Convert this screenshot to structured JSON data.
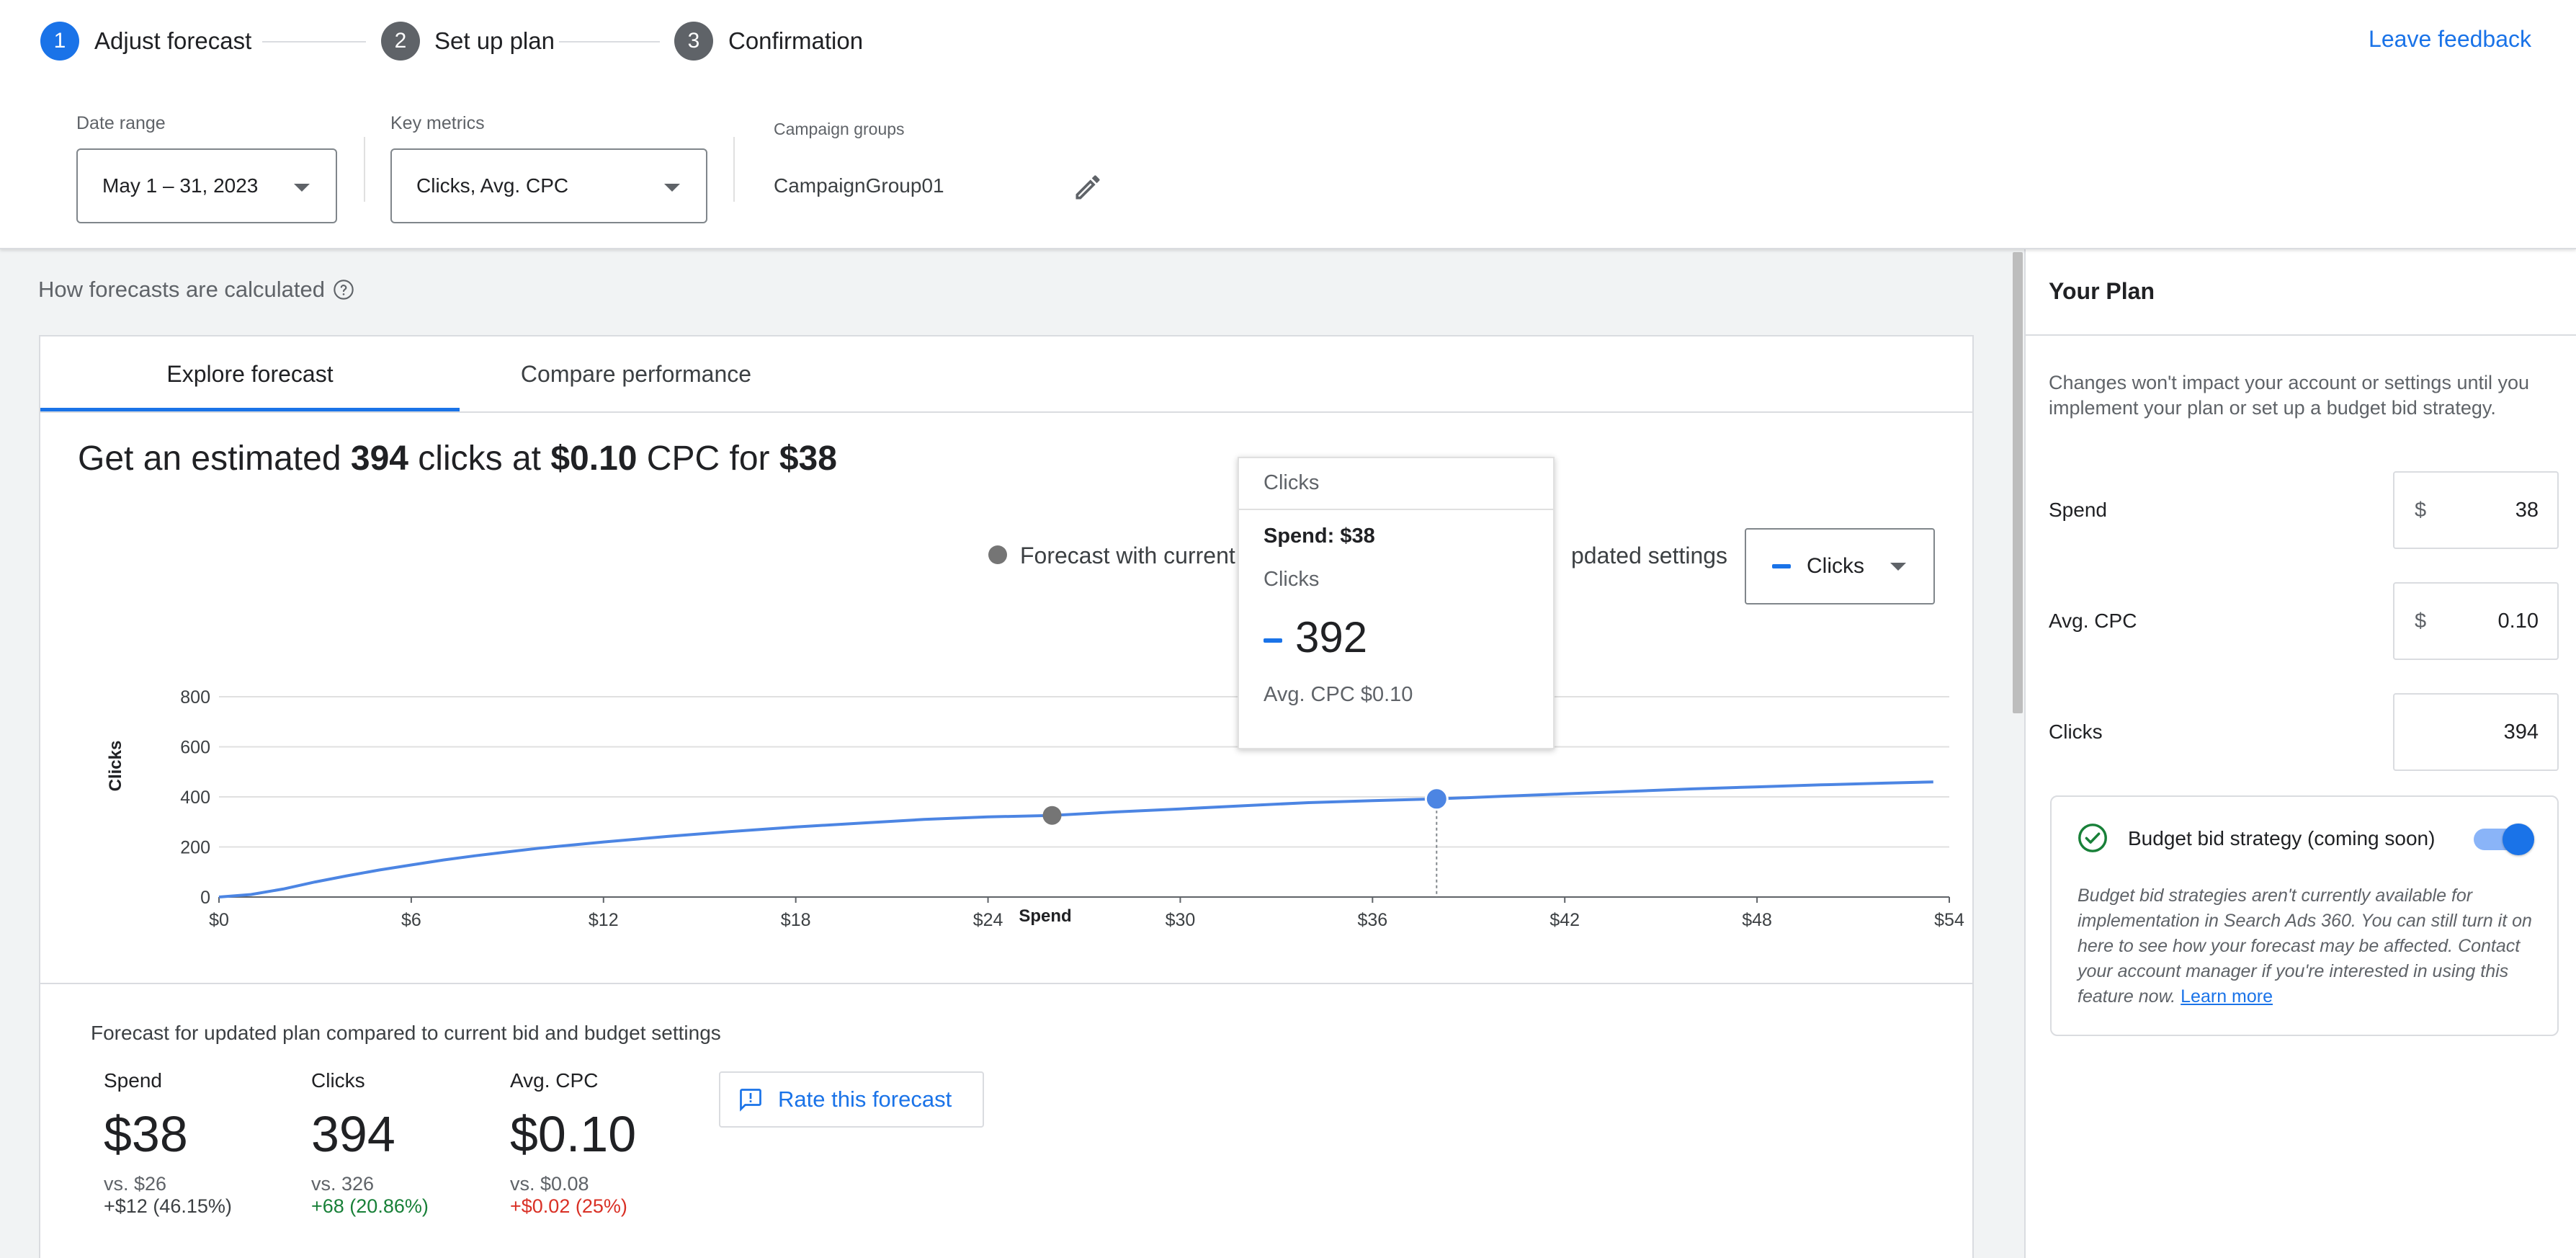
{
  "stepper": {
    "steps": [
      {
        "number": "1",
        "label": "Adjust forecast"
      },
      {
        "number": "2",
        "label": "Set up plan"
      },
      {
        "number": "3",
        "label": "Confirmation"
      }
    ],
    "feedback_link": "Leave feedback"
  },
  "filters": {
    "date_range": {
      "label": "Date range",
      "value": "May 1 – 31, 2023"
    },
    "key_metrics": {
      "label": "Key metrics",
      "value": "Clicks, Avg. CPC"
    },
    "campaign_groups": {
      "label": "Campaign groups",
      "value": "CampaignGroup01"
    }
  },
  "main": {
    "help_link": "How forecasts are calculated",
    "tabs": [
      {
        "label": "Explore forecast",
        "active": true
      },
      {
        "label": "Compare performance",
        "active": false
      }
    ],
    "headline": {
      "prefix": "Get an estimated ",
      "clicks": "394",
      "mid1": " clicks at ",
      "cpc": "$0.10",
      "mid2": " CPC for ",
      "spend": "$38"
    },
    "legend": {
      "current": "Forecast with current",
      "updated": "pdated settings"
    },
    "metric_dropdown": "Clicks",
    "comparison_caption": "Forecast for updated plan compared to current bid and budget settings",
    "stats": [
      {
        "label": "Spend",
        "value": "$38",
        "vs": "vs. $26",
        "delta": "+$12 (46.15%)",
        "tone": "neutral"
      },
      {
        "label": "Clicks",
        "value": "394",
        "vs": "vs. 326",
        "delta": "+68 (20.86%)",
        "tone": "green"
      },
      {
        "label": "Avg. CPC",
        "value": "$0.10",
        "vs": "vs. $0.08",
        "delta": "+$0.02 (25%)",
        "tone": "red"
      }
    ],
    "rate_button": "Rate this forecast"
  },
  "tooltip": {
    "header": "Clicks",
    "spend": "Spend: $38",
    "metric_label": "Clicks",
    "value": "392",
    "cpc": "Avg. CPC $0.10"
  },
  "colors": {
    "accent": "#1a73e8",
    "line": "#4c85e3",
    "current_point": "#757575",
    "green": "#188038",
    "red": "#d93025"
  },
  "chart_data": {
    "type": "line",
    "xlabel": "Spend",
    "ylabel": "Clicks",
    "xlim": [
      0,
      54
    ],
    "ylim": [
      0,
      800
    ],
    "x_ticks": [
      "$0",
      "$6",
      "$12",
      "$18",
      "$24",
      "$30",
      "$36",
      "$42",
      "$48",
      "$54"
    ],
    "y_ticks": [
      "800",
      "600",
      "400",
      "200",
      "0"
    ],
    "grid": true,
    "series": [
      {
        "x": [
          0,
          1,
          2,
          3,
          4,
          5,
          6,
          7,
          8,
          9,
          10,
          12,
          14,
          16,
          18,
          20,
          22,
          24,
          26,
          28,
          30,
          32,
          34,
          36,
          38,
          40,
          42,
          44,
          46,
          48,
          50,
          52,
          53.5
        ],
        "y": [
          0,
          10,
          32,
          60,
          85,
          108,
          128,
          148,
          165,
          180,
          195,
          220,
          242,
          262,
          280,
          295,
          310,
          320,
          326,
          340,
          352,
          365,
          377,
          385,
          392,
          402,
          412,
          422,
          432,
          440,
          448,
          455,
          460
        ]
      }
    ],
    "points": [
      {
        "x": 26,
        "y": 326,
        "kind": "current"
      },
      {
        "x": 38,
        "y": 392,
        "kind": "updated"
      }
    ]
  },
  "panel": {
    "title": "Your Plan",
    "note": "Changes won't impact your account or settings until you implement your plan or set up a budget bid strategy.",
    "fields": [
      {
        "label": "Spend",
        "prefix": "$",
        "value": "38"
      },
      {
        "label": "Avg. CPC",
        "prefix": "$",
        "value": "0.10"
      },
      {
        "label": "Clicks",
        "prefix": "",
        "value": "394"
      }
    ],
    "strategy": {
      "title": "Budget bid strategy (coming soon)",
      "description": "Budget bid strategies aren't currently available for implementation in Search Ads 360. You can still turn it on here to see how your forecast may be affected. Contact your account manager if you're interested in using this feature now. ",
      "learn_more": "Learn more",
      "enabled": true
    }
  }
}
